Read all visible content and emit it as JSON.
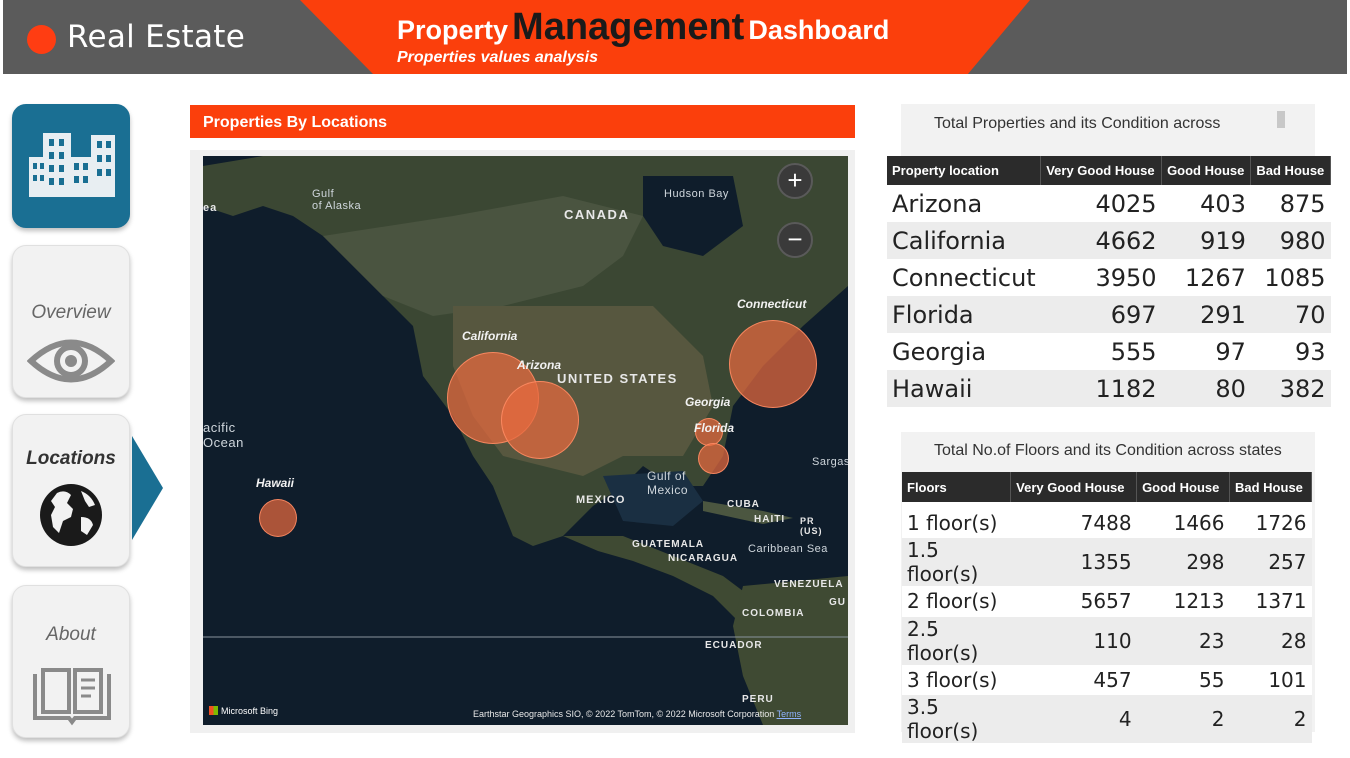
{
  "header": {
    "brand": "Real Estate",
    "title_part1": "Property",
    "title_part2": "Management",
    "title_part3": "Dashboard",
    "subtitle": "Properties values analysis"
  },
  "nav": {
    "items": [
      {
        "label": "",
        "icon": "buildings-icon"
      },
      {
        "label": "Overview",
        "icon": "eye-icon"
      },
      {
        "label": "Locations",
        "icon": "globe-icon",
        "active": true
      },
      {
        "label": "About",
        "icon": "book-icon"
      }
    ]
  },
  "map_section": {
    "title": "Properties By Locations",
    "bubbles": [
      "California",
      "Arizona",
      "Connecticut",
      "Georgia",
      "Florida",
      "Hawaii"
    ],
    "geo_labels": {
      "gulf_alaska": "Gulf\nof Alaska",
      "canada": "CANADA",
      "hudson_bay": "Hudson Bay",
      "united_states": "UNITED STATES",
      "pacific": "Pacific\nOcean",
      "gulf_mexico": "Gulf of\nMexico",
      "mexico": "MEXICO",
      "cuba": "CUBA",
      "haiti": "HAITI",
      "pr": "PR\n(US)",
      "guatemala": "GUATEMALA",
      "nicaragua": "NICARAGUA",
      "caribbean": "Caribbean Sea",
      "sargasso": "Sargas",
      "venezuela": "VENEZUELA",
      "colombia": "COLOMBIA",
      "gu": "GU",
      "ecuador": "ECUADOR",
      "peru": "PERU",
      "ea": "ea"
    },
    "zoom_in": "+",
    "zoom_out": "−",
    "bing": "Microsoft Bing",
    "attribution": "Earthstar Geographics SIO, © 2022 TomTom, © 2022 Microsoft Corporation",
    "terms": "Terms"
  },
  "table_locations": {
    "title": "Total Properties and its Condition across",
    "columns": [
      "Property location",
      "Very Good House",
      "Good House",
      "Bad House"
    ],
    "rows": [
      [
        "Arizona",
        "4025",
        "403",
        "875"
      ],
      [
        "California",
        "4662",
        "919",
        "980"
      ],
      [
        "Connecticut",
        "3950",
        "1267",
        "1085"
      ],
      [
        "Florida",
        "697",
        "291",
        "70"
      ],
      [
        "Georgia",
        "555",
        "97",
        "93"
      ],
      [
        "Hawaii",
        "1182",
        "80",
        "382"
      ]
    ]
  },
  "table_floors": {
    "title": "Total No.of Floors and its Condition across states",
    "columns": [
      "Floors",
      "Very Good House",
      "Good House",
      "Bad House"
    ],
    "rows": [
      [
        "1 floor(s)",
        "7488",
        "1466",
        "1726"
      ],
      [
        "1.5 floor(s)",
        "1355",
        "298",
        "257"
      ],
      [
        "2 floor(s)",
        "5657",
        "1213",
        "1371"
      ],
      [
        "2.5 floor(s)",
        "110",
        "23",
        "28"
      ],
      [
        "3 floor(s)",
        "457",
        "55",
        "101"
      ],
      [
        "3.5 floor(s)",
        "4",
        "2",
        "2"
      ]
    ]
  },
  "colors": {
    "accent": "#fb3f0c",
    "header_bg": "#5b5b5b",
    "nav_blue": "#1a6f93",
    "table_header": "#2b2b2b",
    "bubble": "#e8693e"
  }
}
